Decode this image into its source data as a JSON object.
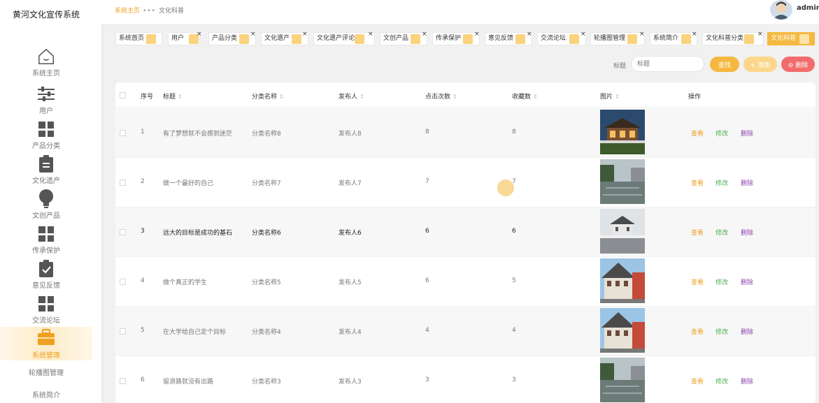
{
  "app": {
    "title": "黄河文化宣传系统"
  },
  "sidebar": {
    "items": [
      {
        "label": "系统主页",
        "icon": "home-icon"
      },
      {
        "label": "用户",
        "icon": "sliders-icon"
      },
      {
        "label": "产品分类",
        "icon": "grid-icon"
      },
      {
        "label": "文化遗产",
        "icon": "clipboard-icon"
      },
      {
        "label": "文创产品",
        "icon": "bulb-icon"
      },
      {
        "label": "传承保护",
        "icon": "grid-icon"
      },
      {
        "label": "意见反馈",
        "icon": "clipboard-check-icon"
      },
      {
        "label": "交流论坛",
        "icon": "grid-icon"
      },
      {
        "label": "系统管理",
        "icon": "briefcase-icon",
        "active": true
      }
    ],
    "subitems": [
      {
        "label": "轮播图管理"
      },
      {
        "label": "系统简介"
      }
    ]
  },
  "header": {
    "breadcrumb": {
      "home": "系统主页",
      "sep": "•••",
      "current": "文化科普"
    },
    "user": "admin"
  },
  "tabs": [
    {
      "label": "系统首页"
    },
    {
      "label": "用户"
    },
    {
      "label": "产品分类"
    },
    {
      "label": "文化遗产"
    },
    {
      "label": "文化遗产评论"
    },
    {
      "label": "文创产品"
    },
    {
      "label": "传承保护"
    },
    {
      "label": "意见反馈"
    },
    {
      "label": "交流论坛"
    },
    {
      "label": "轮播图管理"
    },
    {
      "label": "系统简介"
    },
    {
      "label": "文化科普分类"
    },
    {
      "label": "文化科普",
      "active": true
    }
  ],
  "search": {
    "label": "标题",
    "placeholder": "标题",
    "search_btn": "查找",
    "add_btn": "+ 添加",
    "delete_btn": "⊖ 删除"
  },
  "table": {
    "columns": [
      "序号",
      "标题",
      "分类名称",
      "发布人",
      "点击次数",
      "收藏数",
      "图片",
      "操作"
    ],
    "actions": {
      "view": "查看",
      "edit": "修改",
      "delete": "删除"
    },
    "rows": [
      {
        "no": "1",
        "title": "有了梦想就不会感到迷茫",
        "category": "分类名称8",
        "publisher": "发布人8",
        "clicks": "8",
        "favorites": "8"
      },
      {
        "no": "2",
        "title": "做一个最好的自己",
        "category": "分类名称7",
        "publisher": "发布人7",
        "clicks": "7",
        "favorites": "7"
      },
      {
        "no": "3",
        "title": "远大的目标是成功的基石",
        "category": "分类名称6",
        "publisher": "发布人6",
        "clicks": "6",
        "favorites": "6"
      },
      {
        "no": "4",
        "title": "做个真正的学生",
        "category": "分类名称5",
        "publisher": "发布人5",
        "clicks": "6",
        "favorites": "5"
      },
      {
        "no": "5",
        "title": "在大学给自己定个目标",
        "category": "分类名称4",
        "publisher": "发布人4",
        "clicks": "4",
        "favorites": "4"
      },
      {
        "no": "6",
        "title": "留退路就没有出路",
        "category": "分类名称3",
        "publisher": "发布人3",
        "clicks": "3",
        "favorites": "3"
      }
    ]
  },
  "colors": {
    "accent": "#f5b840",
    "danger": "#f36c6c",
    "edit": "#4caf50",
    "delete_link": "#8e44ad"
  }
}
